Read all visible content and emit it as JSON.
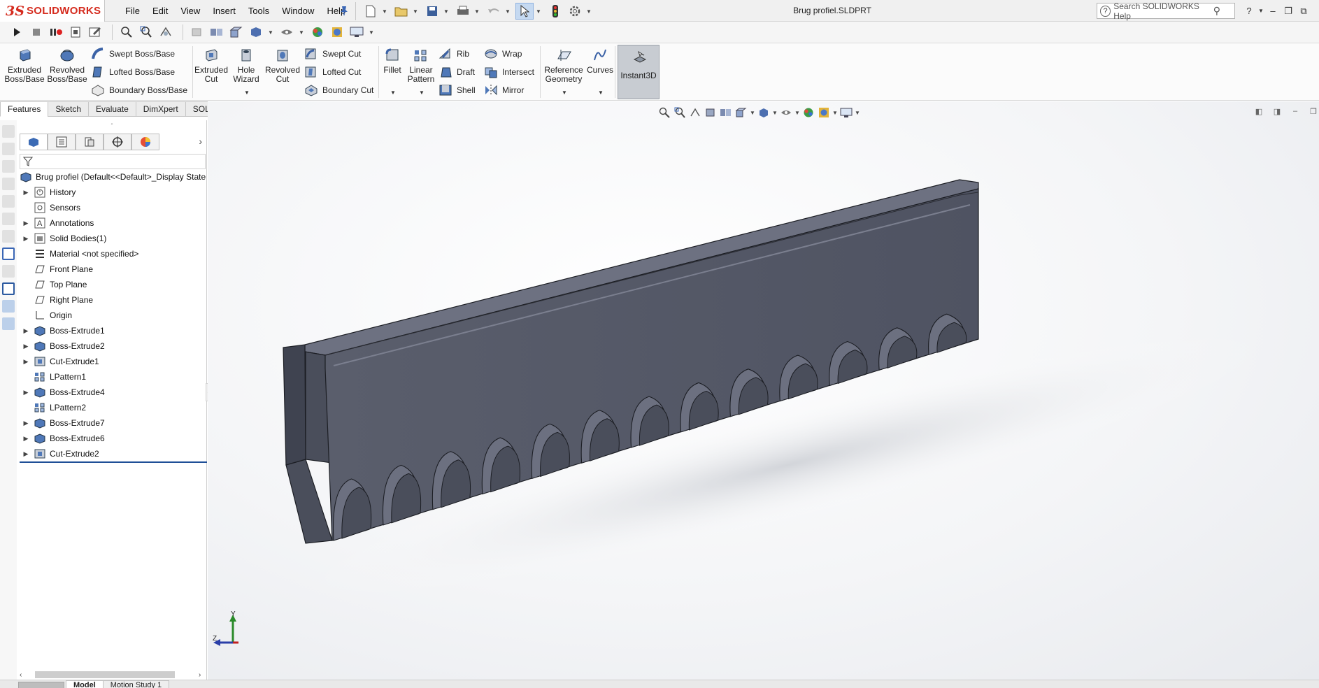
{
  "app": {
    "brand_prefix": "3S",
    "brand_name": "SOLIDWORKS",
    "document_title": "Brug profiel.SLDPRT"
  },
  "menu": [
    "File",
    "Edit",
    "View",
    "Insert",
    "Tools",
    "Window",
    "Help"
  ],
  "help_search": {
    "placeholder": "Search SOLIDWORKS Help"
  },
  "ribbon": {
    "extruded_boss": "Extruded Boss/Base",
    "revolved_boss": "Revolved Boss/Base",
    "swept_boss": "Swept Boss/Base",
    "lofted_boss": "Lofted Boss/Base",
    "boundary_boss": "Boundary Boss/Base",
    "extruded_cut": "Extruded Cut",
    "hole_wizard": "Hole Wizard",
    "revolved_cut": "Revolved Cut",
    "swept_cut": "Swept Cut",
    "lofted_cut": "Lofted Cut",
    "boundary_cut": "Boundary Cut",
    "fillet": "Fillet",
    "linear_pattern": "Linear Pattern",
    "rib": "Rib",
    "draft": "Draft",
    "shell": "Shell",
    "wrap": "Wrap",
    "intersect": "Intersect",
    "mirror": "Mirror",
    "reference_geometry": "Reference Geometry",
    "curves": "Curves",
    "instant3d": "Instant3D"
  },
  "cm_tabs": [
    "Features",
    "Sketch",
    "Evaluate",
    "DimXpert",
    "SOLIDWORKS Add-Ins"
  ],
  "feature_tree": {
    "root": "Brug profiel  (Default<<Default>_Display State",
    "items": [
      {
        "label": "History",
        "expandable": true
      },
      {
        "label": "Sensors",
        "expandable": false
      },
      {
        "label": "Annotations",
        "expandable": true
      },
      {
        "label": "Solid Bodies(1)",
        "expandable": true
      },
      {
        "label": "Material <not specified>",
        "expandable": false
      },
      {
        "label": "Front Plane",
        "expandable": false
      },
      {
        "label": "Top Plane",
        "expandable": false
      },
      {
        "label": "Right Plane",
        "expandable": false
      },
      {
        "label": "Origin",
        "expandable": false
      },
      {
        "label": "Boss-Extrude1",
        "expandable": true
      },
      {
        "label": "Boss-Extrude2",
        "expandable": true
      },
      {
        "label": "Cut-Extrude1",
        "expandable": true
      },
      {
        "label": "LPattern1",
        "expandable": false
      },
      {
        "label": "Boss-Extrude4",
        "expandable": true
      },
      {
        "label": "LPattern2",
        "expandable": false
      },
      {
        "label": "Boss-Extrude7",
        "expandable": true
      },
      {
        "label": "Boss-Extrude6",
        "expandable": true
      },
      {
        "label": "Cut-Extrude2",
        "expandable": true
      }
    ]
  },
  "triad": {
    "y": "Y",
    "z": "Z"
  },
  "bottom_tabs": [
    "Model",
    "Motion Study 1"
  ],
  "colors": {
    "accent": "#1f4f97",
    "brand": "#d52b1e",
    "model_face": "#5a5e6c",
    "model_top": "#6c7080"
  }
}
